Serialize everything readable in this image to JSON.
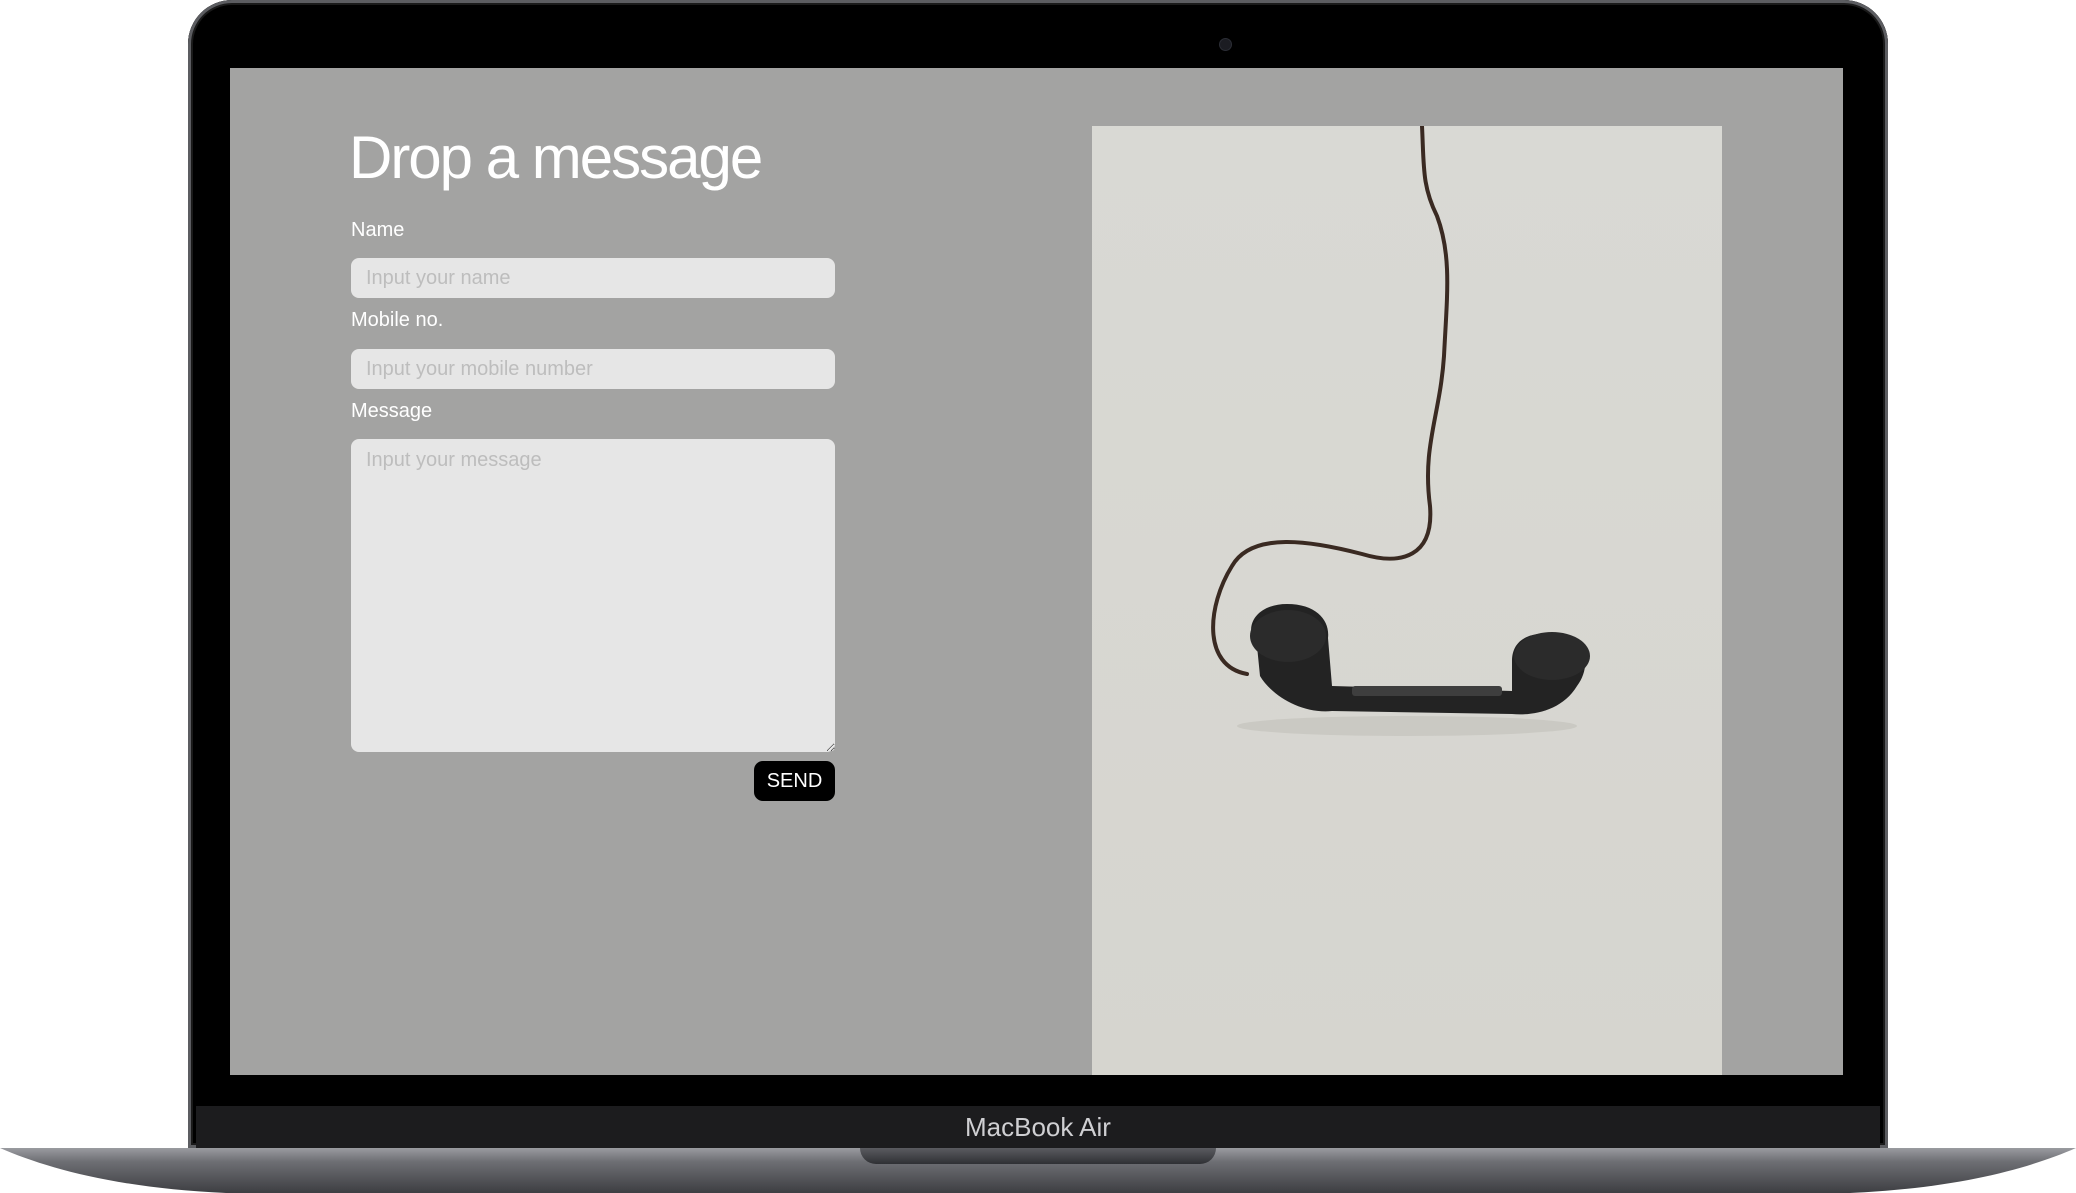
{
  "form": {
    "title": "Drop a message",
    "name_label": "Name",
    "name_placeholder": "Input your name",
    "mobile_label": "Mobile no.",
    "mobile_placeholder": "Input your mobile number",
    "message_label": "Message",
    "message_placeholder": "Input your message",
    "send_label": "SEND"
  },
  "device": {
    "brand_label": "MacBook Air"
  },
  "colors": {
    "page_background": "#a3a3a2",
    "input_background": "#e6e6e6",
    "button_background": "#000000",
    "text": "#ffffff"
  },
  "icons": {
    "photo": "telephone-handset-image"
  }
}
